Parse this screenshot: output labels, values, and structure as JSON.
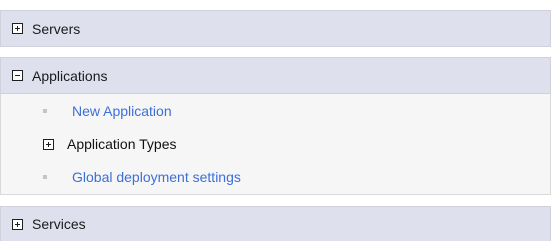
{
  "nav": {
    "sections": [
      {
        "label": "Servers",
        "state": "collapsed",
        "icon": "plus-box-icon"
      },
      {
        "label": "Applications",
        "state": "expanded",
        "icon": "minus-box-icon",
        "items": [
          {
            "label": "New Application",
            "type": "link",
            "icon": "bullet-icon"
          },
          {
            "label": "Application Types",
            "type": "group",
            "state": "collapsed",
            "icon": "plus-box-icon"
          },
          {
            "label": "Global deployment settings",
            "type": "link",
            "icon": "bullet-icon"
          }
        ]
      },
      {
        "label": "Services",
        "state": "collapsed",
        "icon": "plus-box-icon"
      }
    ]
  },
  "colors": {
    "header_bg": "#dfe0ee",
    "body_bg": "#f6f6f6",
    "link": "#3c6fd8",
    "bullet": "#c4c4c4"
  }
}
